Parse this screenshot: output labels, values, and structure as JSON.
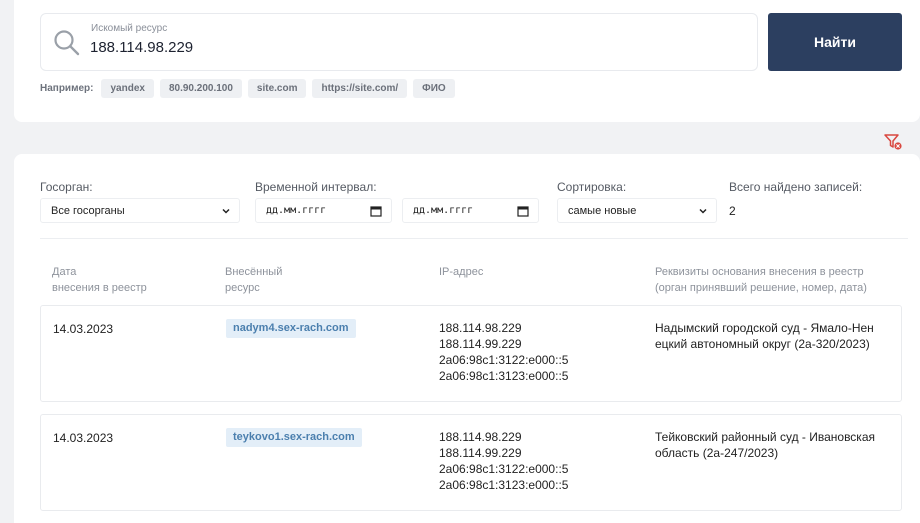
{
  "search": {
    "label": "Искомый ресурс",
    "value": "188.114.98.229",
    "button_label": "Найти",
    "examples_label": "Например:",
    "examples": [
      "yandex",
      "80.90.200.100",
      "site.com",
      "https://site.com/",
      "ФИО"
    ]
  },
  "filters": {
    "agency_label": "Госорган:",
    "agency_value": "Все госорганы",
    "interval_label": "Временной интервал:",
    "date_from_placeholder": "дд.мм.гггг",
    "date_to_placeholder": "дд.мм.гггг",
    "sort_label": "Сортировка:",
    "sort_value": "самые новые",
    "total_label": "Всего найдено записей:",
    "total_value": "2"
  },
  "table": {
    "headers": [
      "Дата\nвнесения в реестр",
      "Внесённый\nресурс",
      "IP-адрес",
      "Реквизиты основания внесения в реестр\n(орган принявший решение, номер, дата)"
    ],
    "rows": [
      {
        "date": "14.03.2023",
        "resource": "nadym4.sex-rach.com",
        "ips": [
          "188.114.98.229",
          "188.114.99.229",
          "2a06:98c1:3122:e000::5",
          "2a06:98c1:3123:e000::5"
        ],
        "basis": "Надымский городской суд - Ямало-Нен\nецкий автономный округ (2а-320/2023)"
      },
      {
        "date": "14.03.2023",
        "resource": "teykovo1.sex-rach.com",
        "ips": [
          "188.114.98.229",
          "188.114.99.229",
          "2a06:98c1:3122:e000::5",
          "2a06:98c1:3123:e000::5"
        ],
        "basis": "Тейковский районный суд - Ивановская\nобласть (2а-247/2023)"
      }
    ]
  },
  "colors": {
    "accent": "#2c3f60",
    "chip_bg": "#e3eef8",
    "chip_text": "#4b7fae",
    "filter_reset_icon": "#d9473f"
  }
}
